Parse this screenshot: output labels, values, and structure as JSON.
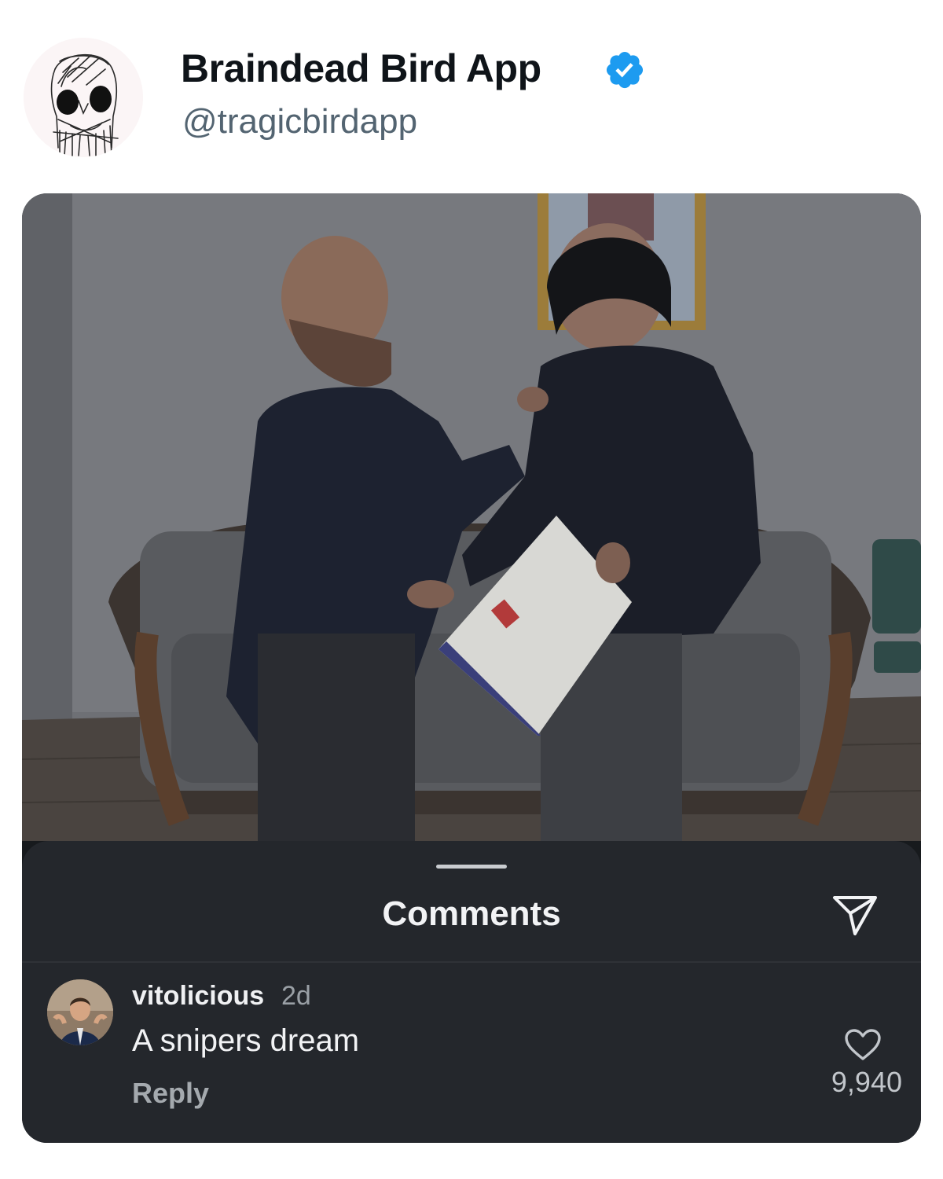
{
  "header": {
    "display_name": "Braindead Bird App",
    "handle": "@tragicbirdapp",
    "verified": true,
    "avatar_icon": "skull-sketch-icon"
  },
  "comments_sheet": {
    "title": "Comments",
    "send_icon": "send-icon",
    "comment": {
      "username": "vitolicious",
      "time": "2d",
      "text": "A snipers dream",
      "reply_label": "Reply",
      "like_count": "9,940",
      "like_icon": "heart-icon"
    }
  },
  "colors": {
    "verified_blue": "#1d9bf0",
    "sheet_background": "#24272c",
    "handle_gray": "#536471"
  }
}
